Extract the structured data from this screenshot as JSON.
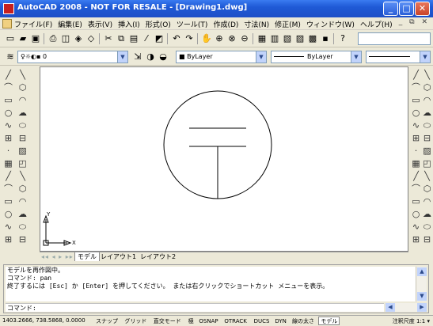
{
  "window": {
    "title": "AutoCAD 2008 - NOT FOR RESALE - [Drawing1.dwg]",
    "controls": {
      "minimize": "_",
      "maximize": "□",
      "close": "✕"
    }
  },
  "menu": {
    "items": [
      "ファイル(F)",
      "編集(E)",
      "表示(V)",
      "挿入(I)",
      "形式(O)",
      "ツール(T)",
      "作成(D)",
      "寸法(N)",
      "修正(M)",
      "ウィンドウ(W)",
      "ヘルプ(H)"
    ],
    "mdi_controls": "_ ⧉ ✕"
  },
  "layer_toolbar": {
    "layer_combo_value": "0",
    "color_combo_value": "ByLayer",
    "linetype_combo_value": "ByLayer"
  },
  "tabs": {
    "nav": "◂◂ ◂ ▸ ▸▸",
    "items": [
      {
        "label": "モデル",
        "active": true
      },
      {
        "label": "レイアウト1",
        "active": false
      },
      {
        "label": "レイアウト2",
        "active": false
      }
    ]
  },
  "ucs": {
    "x_label": "X",
    "y_label": "Y"
  },
  "command": {
    "history": [
      "モデルを再作図中。",
      "コマンド: pan",
      "終了するには [Esc] か [Enter] を押してください。 または右クリックでショートカット メニューを表示。"
    ],
    "prompt": "コマンド:"
  },
  "status": {
    "coordinates": "1403.2666, 738.5868, 0.0000",
    "toggles": [
      {
        "label": "スナップ",
        "on": false
      },
      {
        "label": "グリッド",
        "on": false
      },
      {
        "label": "直交モード",
        "on": false
      },
      {
        "label": "極",
        "on": false
      },
      {
        "label": "OSNAP",
        "on": false
      },
      {
        "label": "OTRACK",
        "on": false
      },
      {
        "label": "DUCS",
        "on": false
      },
      {
        "label": "DYN",
        "on": false
      },
      {
        "label": "線の太さ",
        "on": false
      },
      {
        "label": "モデル",
        "on": true
      }
    ],
    "annotation_scale_label": "注釈尺度",
    "annotation_scale_value": "1:1"
  },
  "colors": {
    "titlebar": "#1f5ad6",
    "chrome": "#ece9d8",
    "canvas": "#ffffff",
    "close_button": "#c9442a"
  },
  "icons": {
    "left_strip": [
      "line-icon",
      "construction-line-icon",
      "polyline-icon",
      "polygon-icon",
      "rectangle-icon",
      "arc-icon",
      "circle-icon",
      "revision-cloud-icon",
      "spline-icon",
      "ellipse-icon",
      "insert-block-icon",
      "make-block-icon",
      "point-icon",
      "hatch-icon"
    ],
    "right_strip": [
      "erase-icon",
      "copy-icon",
      "mirror-icon",
      "offset-icon",
      "array-icon",
      "move-icon",
      "rotate-icon",
      "scale-icon",
      "stretch-icon",
      "trim-icon",
      "extend-icon",
      "break-icon",
      "join-icon",
      "chamfer-icon",
      "fillet-icon",
      "explode-icon"
    ]
  }
}
